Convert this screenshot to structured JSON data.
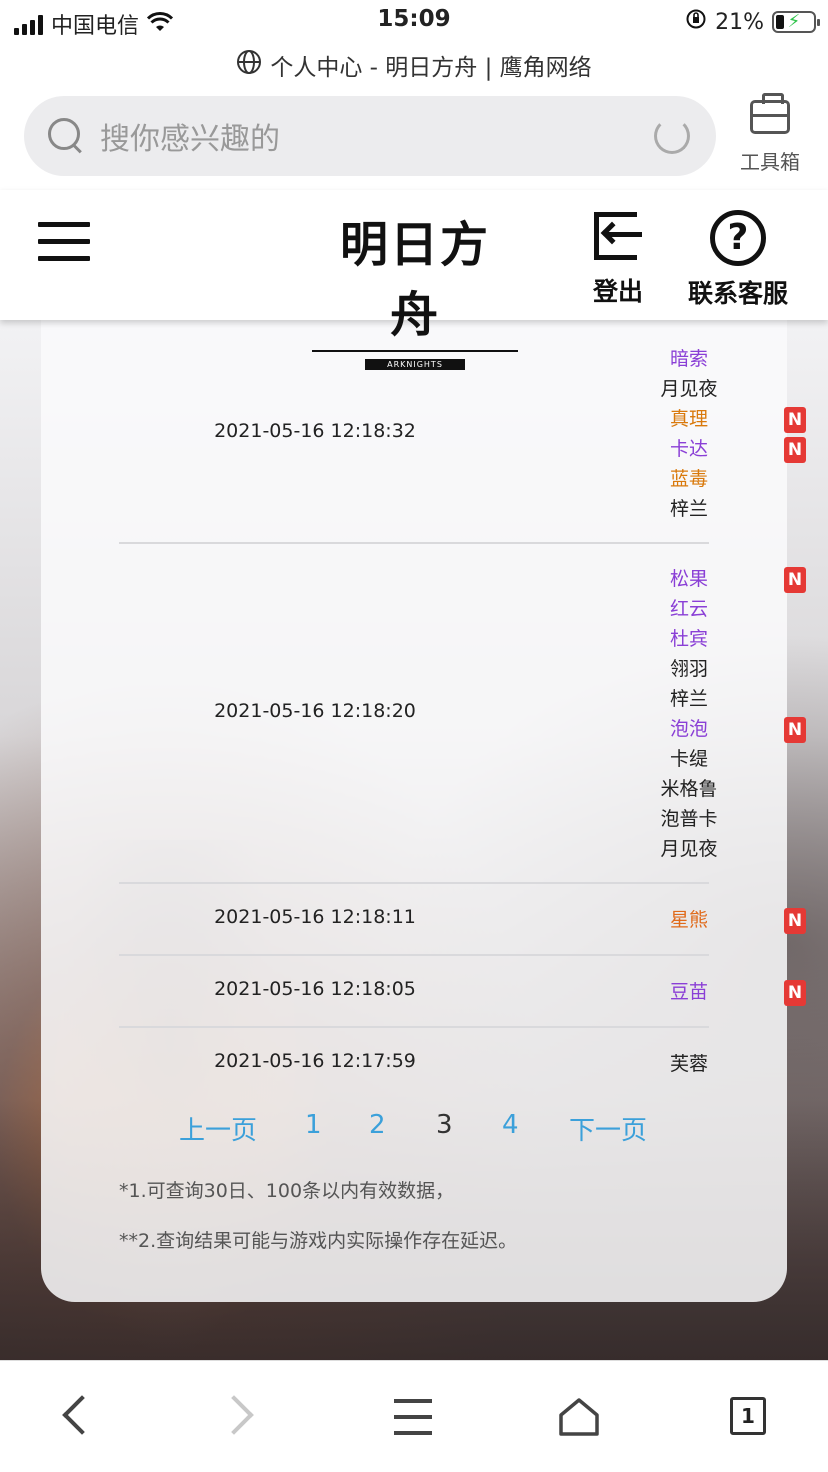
{
  "status_bar": {
    "carrier": "中国电信",
    "time": "15:09",
    "battery": "21%"
  },
  "url_bar": {
    "title": "个人中心 - 明日方舟 | 鹰角网络"
  },
  "search": {
    "placeholder": "搜你感兴趣的"
  },
  "toolbox": {
    "label": "工具箱"
  },
  "site_header": {
    "logo_text": "明日方舟",
    "logo_sub": "ARKNIGHTS",
    "logout_label": "登出",
    "support_label": "联系客服"
  },
  "records": [
    {
      "date": "2021-05-16 12:18:32",
      "operators": [
        {
          "name": "暗索",
          "color": "#8a3fd6",
          "new": false
        },
        {
          "name": "月见夜",
          "color": "#222222",
          "new": false
        },
        {
          "name": "真理",
          "color": "#d9790c",
          "new": true
        },
        {
          "name": "卡达",
          "color": "#8a3fd6",
          "new": true
        },
        {
          "name": "蓝毒",
          "color": "#d9790c",
          "new": false
        },
        {
          "name": "梓兰",
          "color": "#222222",
          "new": false
        }
      ]
    },
    {
      "date": "2021-05-16 12:18:20",
      "operators": [
        {
          "name": "松果",
          "color": "#8a3fd6",
          "new": true
        },
        {
          "name": "红云",
          "color": "#8a3fd6",
          "new": false
        },
        {
          "name": "杜宾",
          "color": "#8a3fd6",
          "new": false
        },
        {
          "name": "翎羽",
          "color": "#222222",
          "new": false
        },
        {
          "name": "梓兰",
          "color": "#222222",
          "new": false
        },
        {
          "name": "泡泡",
          "color": "#8a3fd6",
          "new": true
        },
        {
          "name": "卡缇",
          "color": "#222222",
          "new": false
        },
        {
          "name": "米格鲁",
          "color": "#222222",
          "new": false
        },
        {
          "name": "泡普卡",
          "color": "#222222",
          "new": false
        },
        {
          "name": "月见夜",
          "color": "#222222",
          "new": false
        }
      ]
    },
    {
      "date": "2021-05-16 12:18:11",
      "operators": [
        {
          "name": "星熊",
          "color": "#e06a1a",
          "new": true
        }
      ]
    },
    {
      "date": "2021-05-16 12:18:05",
      "operators": [
        {
          "name": "豆苗",
          "color": "#8a3fd6",
          "new": true
        }
      ]
    },
    {
      "date": "2021-05-16 12:17:59",
      "operators": [
        {
          "name": "芙蓉",
          "color": "#222222",
          "new": false
        }
      ]
    }
  ],
  "badge_text": "N",
  "pagination": {
    "prev": "上一页",
    "pages": [
      "1",
      "2",
      "3",
      "4"
    ],
    "current": "3",
    "next": "下一页"
  },
  "notes": [
    "*1.可查询30日、100条以内有效数据，",
    "**2.查询结果可能与游戏内实际操作存在延迟。"
  ],
  "bottom_bar": {
    "tab_count": "1"
  }
}
